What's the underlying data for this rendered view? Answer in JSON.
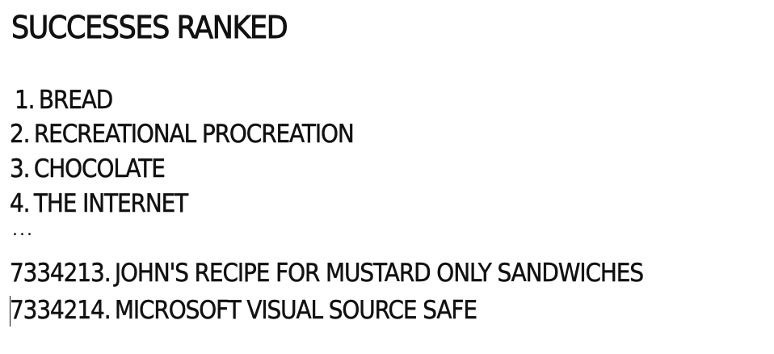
{
  "title": "SUCCESSES RANKED",
  "items": [
    {
      "number": "1.",
      "text": "BREAD"
    },
    {
      "number": "2.",
      "text": "RECREATIONAL PROCREATION"
    },
    {
      "number": "3.",
      "text": "CHOCOLATE"
    },
    {
      "number": "4.",
      "text": "THE INTERNET"
    },
    {
      "number": "7334213.",
      "text": "JOHN'S RECIPE FOR MUSTARD ONLY SANDWICHES"
    },
    {
      "number": "7334214.",
      "text": "MICROSOFT VISUAL SOURCE SAFE"
    }
  ],
  "ellipsis": "..."
}
